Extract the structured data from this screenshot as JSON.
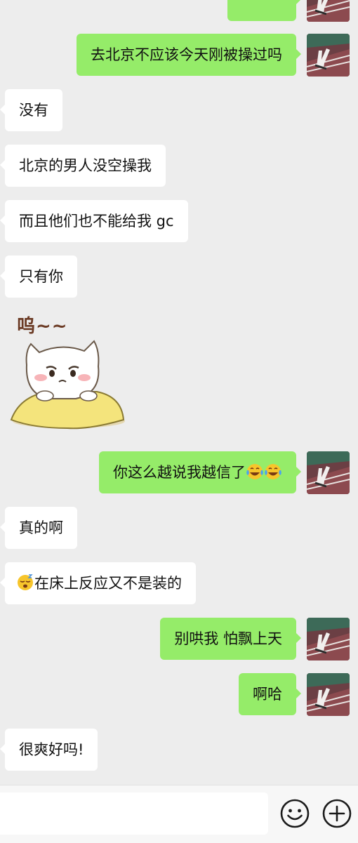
{
  "conversation": {
    "messages": [
      {
        "id": "m0",
        "side": "out",
        "text": "",
        "partial": true
      },
      {
        "id": "m1",
        "side": "out",
        "text": "去北京不应该今天刚被操过吗"
      },
      {
        "id": "m2",
        "side": "in",
        "text": "没有"
      },
      {
        "id": "m3",
        "side": "in",
        "text": "北京的男人没空操我"
      },
      {
        "id": "m4",
        "side": "in",
        "text": "而且他们也不能给我 gc"
      },
      {
        "id": "m5",
        "side": "in",
        "text": "只有你"
      },
      {
        "id": "m6",
        "side": "in",
        "type": "sticker",
        "sticker_text": "呜~~",
        "sticker_name": "crying-cat-sticker"
      },
      {
        "id": "m7",
        "side": "out",
        "text": "你这么越说我越信了",
        "emojis": [
          "laugh-cry-emoji",
          "laugh-cry-emoji"
        ]
      },
      {
        "id": "m8",
        "side": "in",
        "text": "真的啊"
      },
      {
        "id": "m9",
        "side": "in",
        "text": "在床上反应又不是装的",
        "emoji_prefix": "sleepy-face-emoji"
      },
      {
        "id": "m10",
        "side": "out",
        "text": "别哄我 怕飘上天"
      },
      {
        "id": "m11",
        "side": "out",
        "text": "啊哈"
      },
      {
        "id": "m12",
        "side": "in",
        "text": "很爽好吗!"
      }
    ]
  },
  "input_bar": {
    "placeholder": "",
    "value": "",
    "emoji_button_icon": "smiley-icon",
    "more_button_icon": "plus-circle-icon"
  },
  "colors": {
    "background": "#ededed",
    "incoming_bubble": "#ffffff",
    "outgoing_bubble": "#95ec69"
  }
}
